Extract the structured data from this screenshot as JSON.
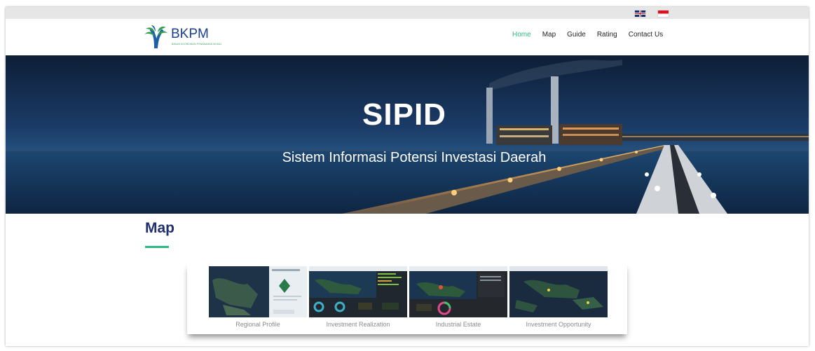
{
  "header": {
    "logo_text": "BKPM",
    "logo_subtext": "BADAN KOORDINASI PENANAMAN MODAL",
    "nav": [
      {
        "label": "Home",
        "active": true
      },
      {
        "label": "Map",
        "active": false
      },
      {
        "label": "Guide",
        "active": false
      },
      {
        "label": "Rating",
        "active": false
      },
      {
        "label": "Contact Us",
        "active": false
      }
    ]
  },
  "languages": [
    "uk-flag-icon",
    "indonesia-flag-icon"
  ],
  "hero": {
    "title": "SIPID",
    "subtitle": "Sistem Informasi Potensi Investasi Daerah"
  },
  "map_section": {
    "title": "Map",
    "cards": [
      {
        "caption": "Regional Profile"
      },
      {
        "caption": "Investment Realization"
      },
      {
        "caption": "Industrial Estate"
      },
      {
        "caption": "Investment Opportunity"
      }
    ]
  },
  "colors": {
    "accent": "#2eb886",
    "brand": "#1b3f8f",
    "section_title": "#20306e"
  }
}
